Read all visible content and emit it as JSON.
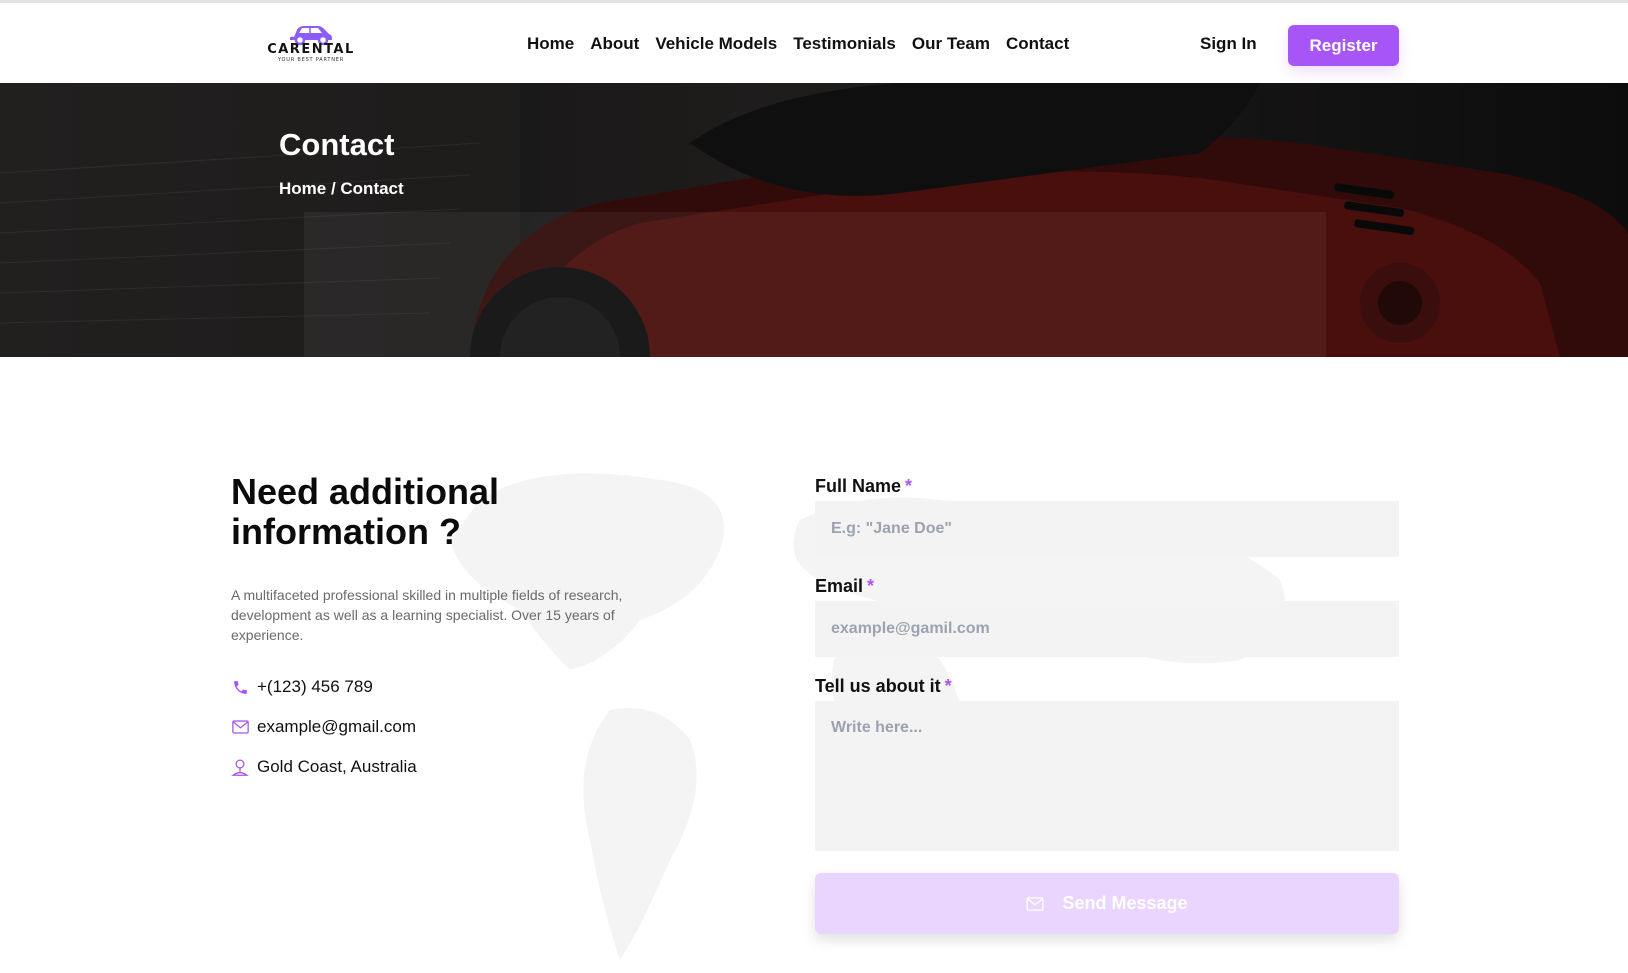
{
  "brand": {
    "name": "CARENTAL",
    "tagline": "YOUR BEST PARTNER"
  },
  "nav": {
    "items": [
      "Home",
      "About",
      "Vehicle Models",
      "Testimonials",
      "Our Team",
      "Contact"
    ]
  },
  "auth": {
    "signin_label": "Sign In",
    "register_label": "Register"
  },
  "hero": {
    "title": "Contact",
    "breadcrumb": "Home / Contact"
  },
  "info": {
    "title": "Need additional information ?",
    "description": "A multifaceted professional skilled in multiple fields of research, development as well as a learning specialist. Over 15 years of experience.",
    "phone": "+(123) 456 789",
    "email": "example@gmail.com",
    "location": "Gold Coast, Australia"
  },
  "form": {
    "name_label": "Full Name",
    "name_placeholder": "E.g: \"Jane Doe\"",
    "email_label": "Email",
    "email_placeholder": "example@gamil.com",
    "message_label": "Tell us about it",
    "message_placeholder": "Write here...",
    "required_mark": "*",
    "submit_label": "Send Message"
  },
  "colors": {
    "accent": "#a855f7",
    "accent_light": "#e9d5ff",
    "field_bg": "#f3f3f3"
  },
  "icons": {
    "phone": "phone-icon",
    "email": "mail-icon",
    "location": "location-pin-icon",
    "submit": "mail-icon"
  }
}
